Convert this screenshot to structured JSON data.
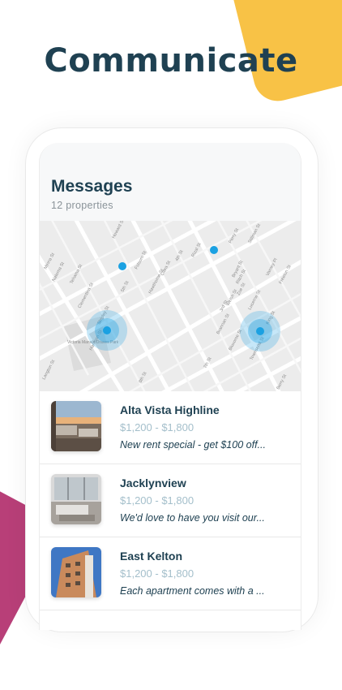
{
  "headline": "Communicate",
  "messages": {
    "title": "Messages",
    "subtitle": "12 properties"
  },
  "map": {
    "marker_color": "#1ba1e2",
    "street_labels": [
      "Howard St",
      "Folsom St",
      "Minna St",
      "Natoma St",
      "Tehama St",
      "Clementina St",
      "Shipley St",
      "Clara St",
      "Harrison St",
      "Hawthorne St",
      "Perry St",
      "Stillman St",
      "Brannan St",
      "Bryant St",
      "Bluxome St",
      "Townsend St",
      "King St",
      "Berry St",
      "8th St",
      "7th St",
      "5th St",
      "4th St",
      "3rd St",
      "Langton St",
      "Victoria Manalo Draves Park",
      "Ritch St",
      "Zoe St",
      "Welsh St",
      "Freelon St",
      "Varney Pl",
      "Rizal St",
      "Lucerne St"
    ]
  },
  "properties": [
    {
      "name": "Alta Vista Highline",
      "price": "$1,200 - $1,800",
      "snippet": "New rent special - get $100 off..."
    },
    {
      "name": "Jacklynview",
      "price": "$1,200 - $1,800",
      "snippet": "We'd love to have you visit our..."
    },
    {
      "name": "East Kelton",
      "price": "$1,200 - $1,800",
      "snippet": "Each apartment comes with a ..."
    }
  ]
}
